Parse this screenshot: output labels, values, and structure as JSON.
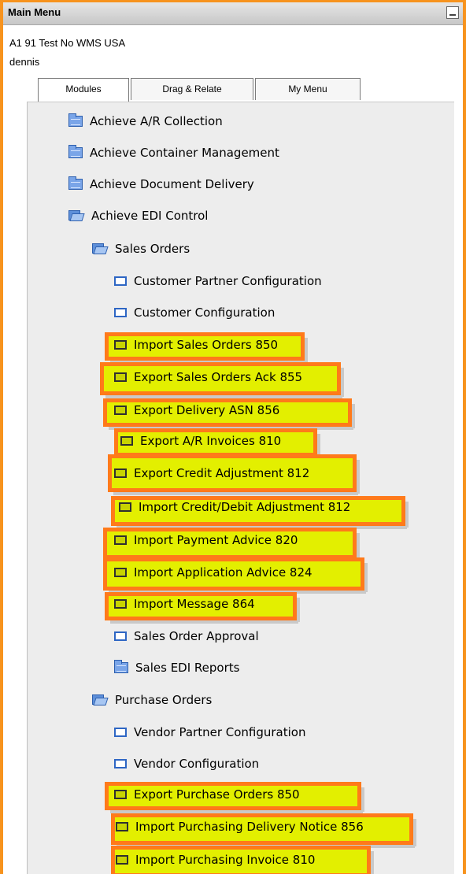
{
  "window": {
    "title": "Main Menu"
  },
  "header": {
    "company": "A1 91 Test No WMS USA",
    "user": "dennis"
  },
  "tabs": [
    {
      "label": "Modules"
    },
    {
      "label": "Drag & Relate"
    },
    {
      "label": "My Menu"
    }
  ],
  "menu": {
    "achieve_ar": "Achieve A/R Collection",
    "achieve_container": "Achieve Container Management",
    "achieve_delivery": "Achieve Document Delivery",
    "achieve_edi": "Achieve EDI Control",
    "sales_orders": "Sales Orders",
    "customer_partner_config": "Customer Partner Configuration",
    "customer_config": "Customer Configuration",
    "import_sales_orders": "Import Sales Orders 850",
    "export_sales_orders_ack": "Export Sales Orders Ack 855",
    "export_delivery_asn": "Export Delivery ASN 856",
    "export_ar_invoices": "Export A/R Invoices 810",
    "export_credit_adjustment": "Export Credit Adjustment 812",
    "import_credit_debit_adjustment": "Import Credit/Debit Adjustment 812",
    "import_payment_advice": "Import Payment Advice 820",
    "import_application_advice": "Import Application Advice 824",
    "import_message": "Import Message 864",
    "sales_order_approval": "Sales Order Approval",
    "sales_edi_reports": "Sales EDI Reports",
    "purchase_orders": "Purchase Orders",
    "vendor_partner_config": "Vendor Partner Configuration",
    "vendor_config": "Vendor Configuration",
    "export_purchase_orders": "Export Purchase Orders 850",
    "import_purchasing_delivery_notice": "Import Purchasing Delivery Notice 856",
    "import_purchasing_invoice": "Import Purchasing Invoice 810"
  },
  "colors": {
    "highlight_border": "#ff7a1a",
    "highlight_fill": "#e3ef00",
    "frame": "#f7931e"
  }
}
